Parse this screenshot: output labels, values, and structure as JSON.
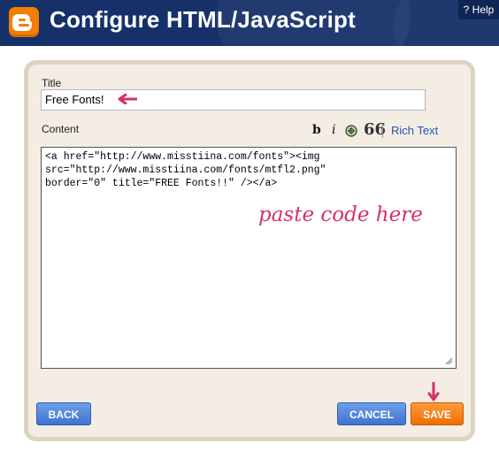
{
  "header": {
    "title": "Configure HTML/JavaScript",
    "help_label": "? Help"
  },
  "colors": {
    "header_bg": "#16316a",
    "logo": "#f57d00",
    "panel_bg": "#f3ede3",
    "button_blue": "#3f73cf",
    "button_orange": "#ef6d00",
    "annotation": "#d8306a"
  },
  "form": {
    "title_label": "Title",
    "title_value": "Free Fonts!",
    "content_label": "Content",
    "toolbar": {
      "bold": "b",
      "italic": "i",
      "quote": "66",
      "rich_text": "Rich Text"
    },
    "content_value": "<a href=\"http://www.misstiina.com/fonts\"><img\nsrc=\"http://www.misstiina.com/fonts/mtfl2.png\"\nborder=\"0\" title=\"FREE Fonts!!\" /></a>",
    "annotation_text": "paste code here"
  },
  "buttons": {
    "back": "BACK",
    "cancel": "CANCEL",
    "save": "SAVE"
  }
}
